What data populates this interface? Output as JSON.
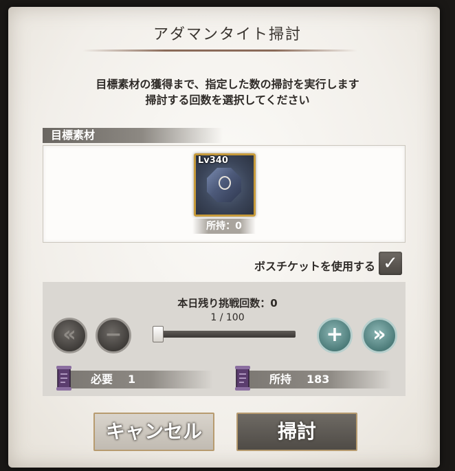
{
  "dialog": {
    "title": "アダマンタイト掃討",
    "description_line1": "目標素材の獲得まで、指定した数の掃討を実行します",
    "description_line2": "掃討する回数を選択してください"
  },
  "target": {
    "section_label": "目標素材",
    "item_level": "Lv340",
    "owned": "所持：0",
    "icon": "adamantite-gem-icon"
  },
  "boss_ticket": {
    "label": "ボスチケットを使用する",
    "checked": true,
    "check_glyph": "✓"
  },
  "counter": {
    "remaining": "本日残り挑戦回数：0",
    "ratio": "1 / 100",
    "slider_value": 1,
    "slider_max": 100,
    "min_glyph": "«",
    "minus_glyph": "−",
    "plus_glyph": "+",
    "max_glyph": "»"
  },
  "resources": {
    "required_label": "必要",
    "required_value": "1",
    "owned_label": "所持",
    "owned_value": "183",
    "icon": "scroll-icon"
  },
  "buttons": {
    "cancel": "キャンセル",
    "sweep": "掃討"
  },
  "colors": {
    "gold_frame": "#c79b3b",
    "teal_button": "#4d7c7a",
    "dark_button": "#3f3c39"
  }
}
